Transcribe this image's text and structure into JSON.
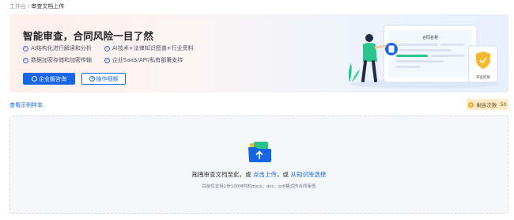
{
  "breadcrumb": {
    "root": "工作台",
    "separator": "/",
    "current": "审查文档上传"
  },
  "banner": {
    "title": "智能审查，合同风险一目了然",
    "features": [
      "AI结构化进行解读和分析",
      "AI技术+法律知识图谱+行业资料",
      "数据加密存储和加密传输",
      "企业SaaS/API/私有部署支持"
    ],
    "primary_button": "企业版咨询",
    "secondary_button": "操作视频",
    "illustration": {
      "doc_title": "合同名称",
      "shield_label": "审查结果",
      "colors": {
        "accent": "#1665e6",
        "green": "#2bc48a",
        "shield": "#f5b82e"
      }
    }
  },
  "toolbar": {
    "sample_link": "查看示例样本",
    "remaining_label": "剩余次数",
    "remaining_count": "50"
  },
  "upload": {
    "main_prefix": "拖拽审查文档至此，或",
    "click_upload": "点击上传",
    "separator": "，或",
    "from_library": "从知识库选择",
    "hint": "目前仅支持1份100M内的docx、doc、pdf格式的合同审查"
  }
}
